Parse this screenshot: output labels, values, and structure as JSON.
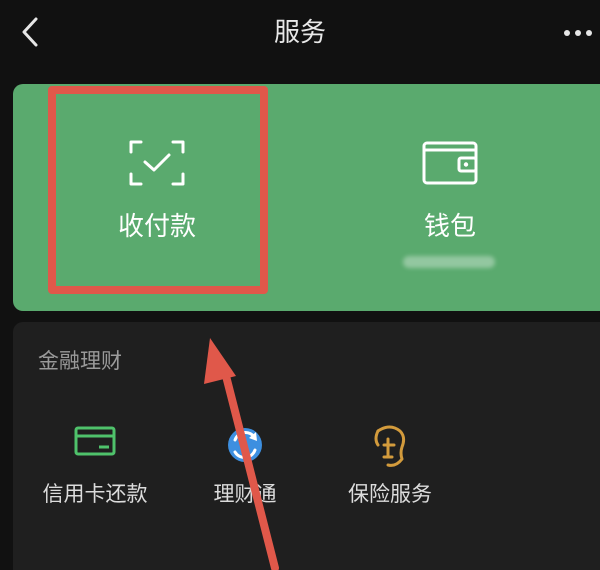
{
  "header": {
    "title": "服务",
    "back_icon": "chevron-left-icon",
    "more_icon": "more-dots-icon"
  },
  "main_card": {
    "color": "#5aaa6e",
    "tiles": [
      {
        "label": "收付款",
        "icon": "scan-check-icon"
      },
      {
        "label": "钱包",
        "icon": "wallet-icon"
      }
    ]
  },
  "annotation": {
    "color": "#e0584a"
  },
  "finance": {
    "title": "金融理财",
    "items": [
      {
        "label": "信用卡还款",
        "icon": "credit-card-icon",
        "color": "#4fc26b"
      },
      {
        "label": "理财通",
        "icon": "licaitong-icon",
        "color": "#3d8fe0"
      },
      {
        "label": "保险服务",
        "icon": "insurance-icon",
        "color": "#d39b3c"
      }
    ]
  }
}
